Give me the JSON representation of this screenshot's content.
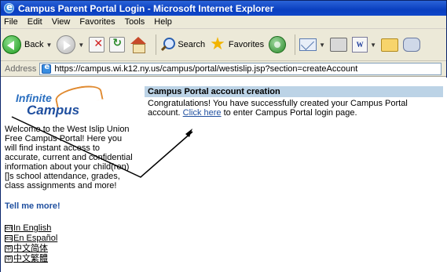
{
  "window": {
    "title": "Campus Parent Portal Login - Microsoft Internet Explorer"
  },
  "menubar": {
    "items": [
      "File",
      "Edit",
      "View",
      "Favorites",
      "Tools",
      "Help"
    ]
  },
  "toolbar": {
    "back_label": "Back",
    "search_label": "Search",
    "favorites_label": "Favorites"
  },
  "address": {
    "label": "Address",
    "url": "https://campus.wi.k12.ny.us/campus/portal/westislip.jsp?section=createAccount"
  },
  "sidebar": {
    "logo_top": "Infinite",
    "logo_bottom": "Campus",
    "welcome_text": "Welcome to the West Islip Union Free Campus Portal! Here you will find instant access to accurate, current and confidential information about your child(ren)[]s school attendance, grades, class assignments and more!",
    "tell_more": "Tell me more!",
    "languages": [
      {
        "badge": "en",
        "label": "In English"
      },
      {
        "badge": "es",
        "label": "En Español"
      },
      {
        "badge": "中",
        "label": "中文简体"
      },
      {
        "badge": "中",
        "label": "中文繁體"
      }
    ]
  },
  "main": {
    "header": "Campus Portal account creation",
    "message_before": "Congratulations! You have successfully created your Campus Portal account. ",
    "link_text": "Click here",
    "message_after": " to enter Campus Portal login page."
  }
}
